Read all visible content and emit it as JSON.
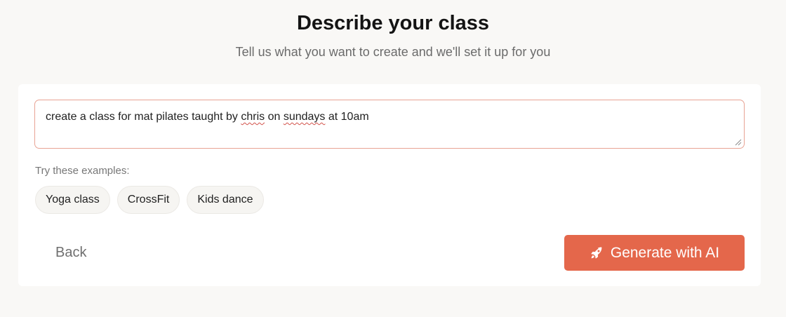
{
  "header": {
    "title": "Describe your class",
    "subtitle": "Tell us what you want to create and we'll set it up for you"
  },
  "prompt": {
    "value_parts": [
      "create a class for mat pilates taught by ",
      "chris",
      " on ",
      "sundays",
      " at 10am"
    ]
  },
  "examples": {
    "label": "Try these examples:",
    "chips": [
      "Yoga class",
      "CrossFit",
      "Kids dance"
    ]
  },
  "actions": {
    "back_label": "Back",
    "generate_label": "Generate with AI",
    "generate_icon": "rocket-icon"
  },
  "colors": {
    "accent": "#e4674b",
    "background": "#f9f8f6",
    "input_border": "#e8a394"
  }
}
